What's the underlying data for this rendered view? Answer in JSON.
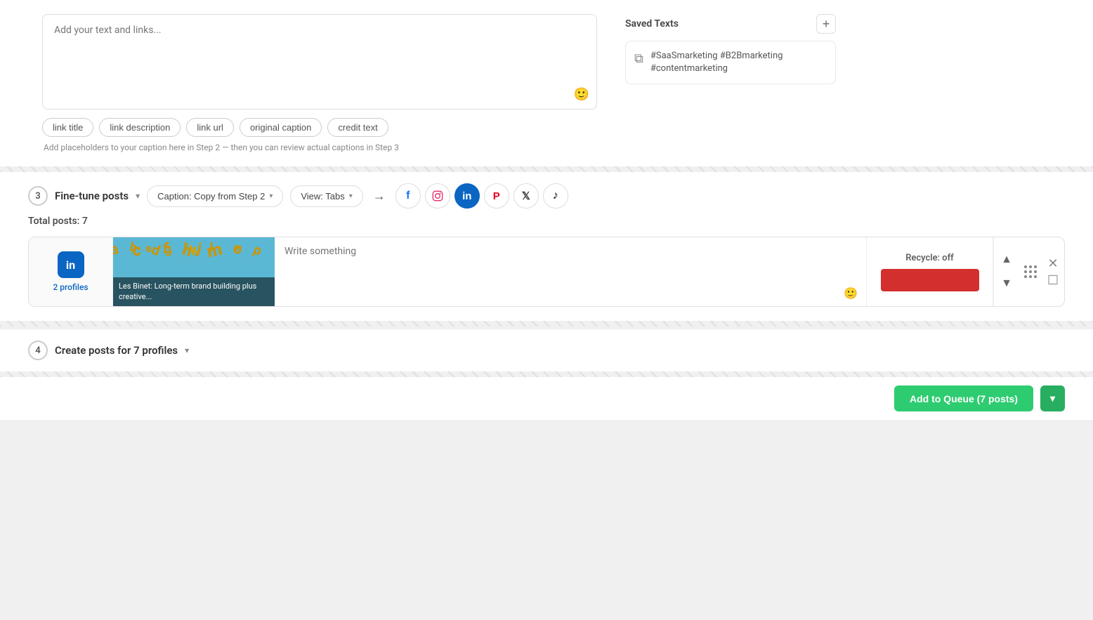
{
  "top": {
    "textarea_placeholder": "Add your text and links...",
    "placeholders": [
      {
        "label": "link title",
        "id": "link-title"
      },
      {
        "label": "link description",
        "id": "link-description"
      },
      {
        "label": "link url",
        "id": "link-url"
      },
      {
        "label": "original caption",
        "id": "original-caption"
      },
      {
        "label": "credit text",
        "id": "credit-text"
      }
    ],
    "placeholder_hint": "Add placeholders to your caption here in Step 2 — then you can review actual captions in Step 3"
  },
  "saved_texts": {
    "title": "Saved Texts",
    "add_button": "+",
    "items": [
      {
        "text": "#SaaSmarketing #B2Bmarketing #contentmarketing"
      }
    ]
  },
  "step3": {
    "number": "3",
    "title": "Fine-tune posts",
    "caption_dropdown": "Caption: Copy from Step 2",
    "view_dropdown": "View: Tabs",
    "total_posts_label": "Total posts: 7",
    "post": {
      "profiles_count": "2 profiles",
      "image_caption": "Les Binet: Long-term brand building plus creative...",
      "write_placeholder": "Write something",
      "recycle_label": "Recycle: off"
    }
  },
  "step4": {
    "number": "4",
    "title": "Create posts for 7 profiles"
  },
  "bottom": {
    "add_queue_label": "Add to Queue (7 posts)"
  },
  "social_icons": [
    {
      "name": "facebook",
      "symbol": "f"
    },
    {
      "name": "instagram",
      "symbol": "📷"
    },
    {
      "name": "linkedin",
      "symbol": "in"
    },
    {
      "name": "pinterest",
      "symbol": "P"
    },
    {
      "name": "twitter",
      "symbol": "𝕏"
    },
    {
      "name": "tiktok",
      "symbol": "♪"
    }
  ]
}
